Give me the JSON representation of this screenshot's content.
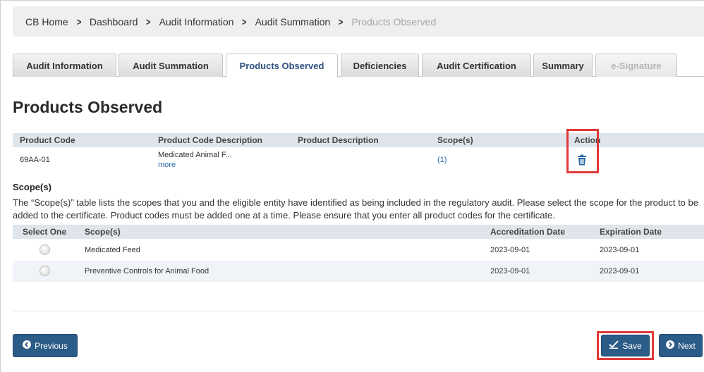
{
  "breadcrumb": [
    "CB Home",
    "Dashboard",
    "Audit Information",
    "Audit Summation",
    "Products Observed"
  ],
  "tabs": [
    "Audit Information",
    "Audit Summation",
    "Products Observed",
    "Deficiencies",
    "Audit Certification",
    "Summary",
    "e-Signature"
  ],
  "page_title": "Products Observed",
  "products_table": {
    "headers": [
      "Product Code",
      "Product Code Description",
      "Product Description",
      "Scope(s)",
      "Action"
    ],
    "rows": [
      {
        "code": "69AA-01",
        "code_description": "Medicated Animal F...",
        "more": "more",
        "product_description": "",
        "scopes": "(1)",
        "action_icon": "trash-icon"
      }
    ]
  },
  "scope_section": {
    "title": "Scope(s)",
    "description": "The “Scope(s)” table lists the scopes that you and the eligible entity have identified as being included in the regulatory audit. Please select the scope for the product to be added to the certificate. Product codes must be added one at a time. Please ensure that you enter all product codes for the certificate.",
    "headers": [
      "Select One",
      "Scope(s)",
      "Accreditation Date",
      "Expiration Date"
    ],
    "rows": [
      {
        "scope": "Medicated Feed",
        "accreditation_date": "2023-09-01",
        "expiration_date": "2023-09-01"
      },
      {
        "scope": "Preventive Controls for Animal Food",
        "accreditation_date": "2023-09-01",
        "expiration_date": "2023-09-01"
      }
    ]
  },
  "buttons": {
    "previous": "Previous",
    "save": "Save",
    "next": "Next"
  },
  "colors": {
    "button": "#2b5b87",
    "link": "#2a6aa8",
    "highlight": "#e03a3a",
    "table_header": "#dfe5ea"
  }
}
